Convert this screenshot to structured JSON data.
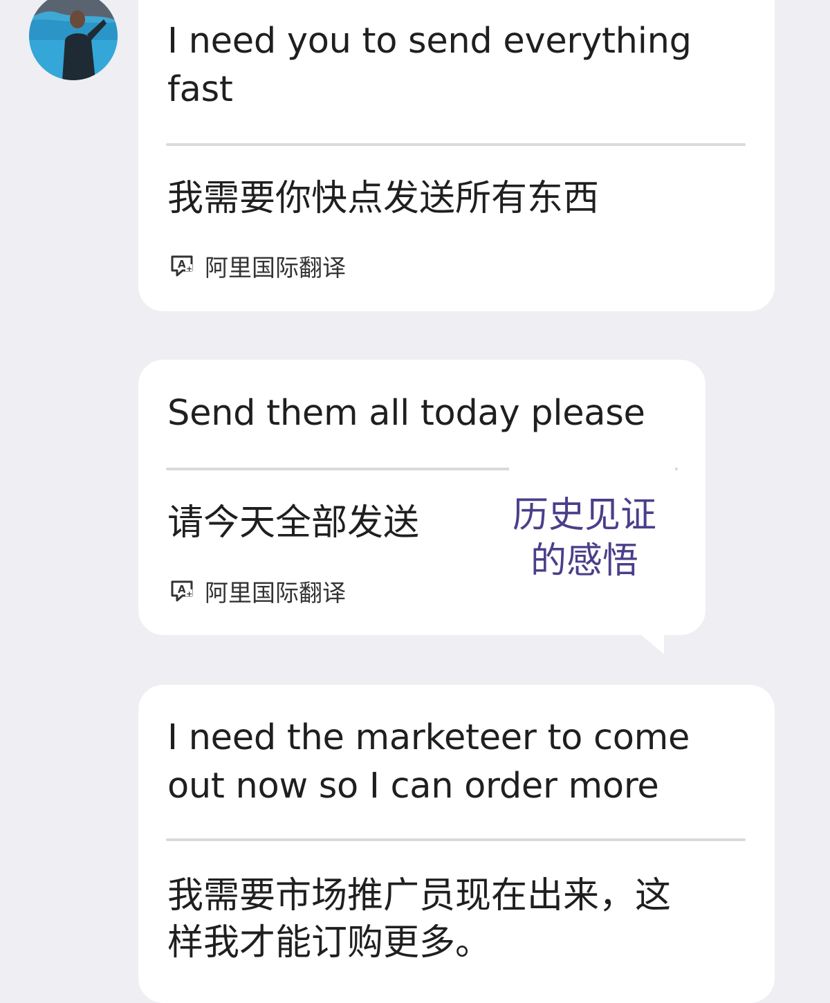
{
  "chat": {
    "translation_service": "阿里国际翻译",
    "messages": [
      {
        "english_lines": [
          "I need you to send everything",
          "fast"
        ],
        "chinese_lines": [
          "我需要你快点发送所有东西"
        ]
      },
      {
        "english_lines": [
          "Send them all today please"
        ],
        "chinese_lines": [
          "请今天全部发送"
        ]
      },
      {
        "english_lines": [
          "I need the marketeer to come",
          "out now so I can order more"
        ],
        "chinese_lines": [
          "我需要市场推广员现在出来，这",
          "样我才能订购更多。"
        ]
      }
    ]
  },
  "watermark": {
    "line1": "历史见证",
    "line2": "的感悟",
    "color": "#4a3f8a"
  },
  "colors": {
    "background": "#eeeef3",
    "bubble": "#ffffff",
    "divider": "#dadadd"
  },
  "icons": {
    "avatar": "user-avatar-photo",
    "translate": "translate-icon"
  }
}
